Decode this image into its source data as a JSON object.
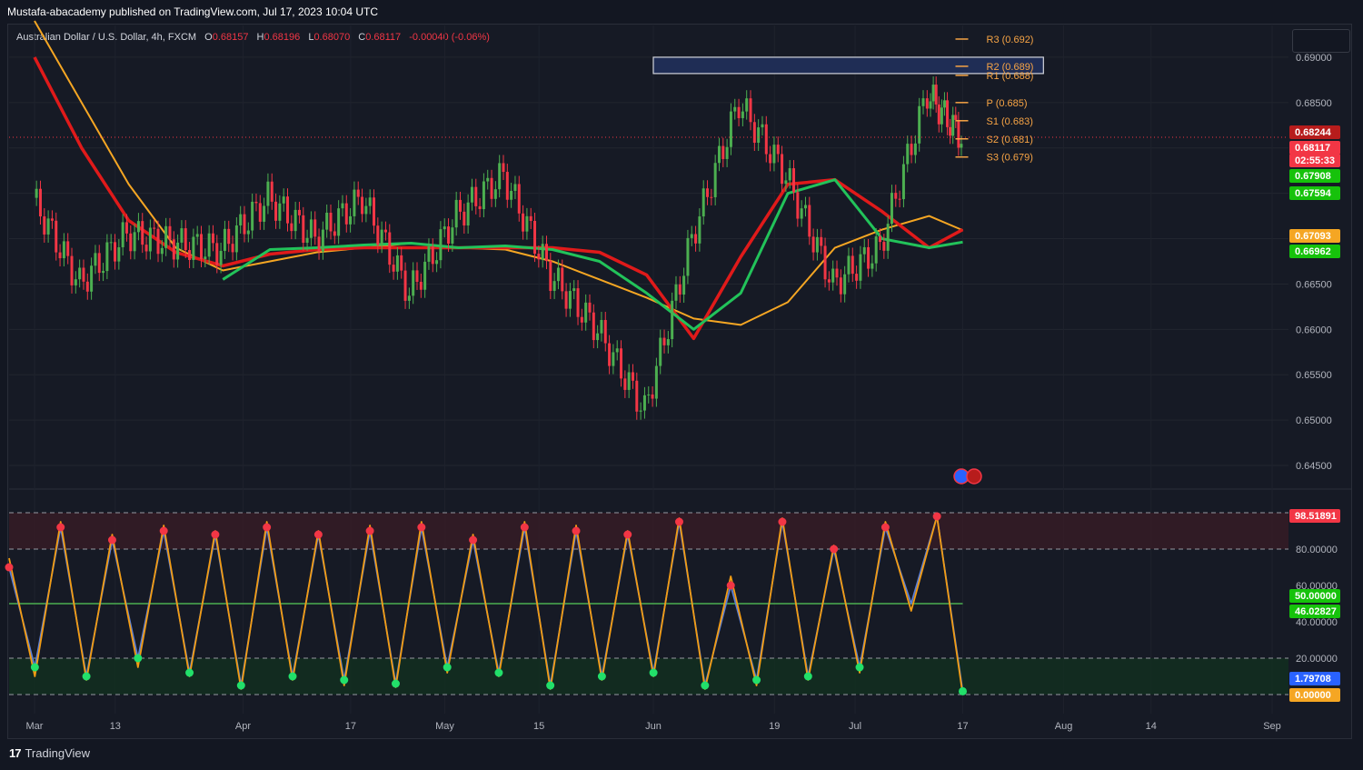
{
  "header": {
    "publisher": "Mustafa-abacademy published on TradingView.com, Jul 17, 2023 10:04 UTC"
  },
  "symbol": {
    "name": "Australian Dollar / U.S. Dollar, 4h, FXCM",
    "o_label": "O",
    "o": "0.68157",
    "h_label": "H",
    "h": "0.68196",
    "l_label": "L",
    "l": "0.68070",
    "c_label": "C",
    "c": "0.68117",
    "change": "-0.00040 (-0.06%)"
  },
  "footer": {
    "logo_text": "TradingView"
  },
  "colors": {
    "background": "#131722",
    "up": "#4caf50",
    "down": "#f23645",
    "ema_red": "#e01a1a",
    "ema_green": "#22c35a",
    "ema_orange": "#f39c12",
    "pivot": "#f7a445",
    "stoch_k": "#5b7fd6",
    "stoch_d": "#f39c12"
  },
  "chart_data": [
    {
      "type": "line",
      "title": "",
      "ylim": [
        0.6425,
        0.6935
      ],
      "y_ticks": [
        "0.69000",
        "0.68500",
        "0.68000",
        "0.67500",
        "0.67000",
        "0.66500",
        "0.66000",
        "0.65500",
        "0.65000",
        "0.64500"
      ],
      "x_ticks": [
        "Mar",
        "13",
        "Apr",
        "17",
        "May",
        "15",
        "Jun",
        "19",
        "Jul",
        "17",
        "Aug",
        "14",
        "Sep"
      ],
      "x": [
        "2023-03-01",
        "2023-03-08",
        "2023-03-15",
        "2023-03-22",
        "2023-03-29",
        "2023-04-05",
        "2023-04-12",
        "2023-04-19",
        "2023-04-26",
        "2023-05-03",
        "2023-05-10",
        "2023-05-17",
        "2023-05-24",
        "2023-05-31",
        "2023-06-07",
        "2023-06-14",
        "2023-06-21",
        "2023-06-28",
        "2023-07-05",
        "2023-07-12",
        "2023-07-17"
      ],
      "series": [
        {
          "values": [
            0.6745,
            0.665,
            0.6705,
            0.6695,
            0.6688,
            0.6745,
            0.67,
            0.6745,
            0.664,
            0.6725,
            0.677,
            0.666,
            0.66,
            0.651,
            0.67,
            0.685,
            0.677,
            0.665,
            0.669,
            0.686,
            0.68117
          ]
        }
      ],
      "overlays": {
        "ma_orange": [
          0.694,
          0.685,
          0.676,
          0.669,
          0.6665,
          0.6675,
          0.6685,
          0.669,
          0.6695,
          0.669,
          0.6688,
          0.6675,
          0.6655,
          0.6635,
          0.6612,
          0.6605,
          0.663,
          0.669,
          0.671,
          0.6725,
          0.67093
        ],
        "ema_red": [
          0.69,
          0.68,
          0.672,
          0.6685,
          0.667,
          0.6683,
          0.6688,
          0.669,
          0.669,
          0.669,
          0.669,
          0.669,
          0.6685,
          0.666,
          0.659,
          0.668,
          0.676,
          0.6765,
          0.673,
          0.669,
          0.671
        ],
        "ema_green": [
          null,
          null,
          null,
          null,
          0.6655,
          0.6688,
          0.669,
          0.6693,
          0.6695,
          0.669,
          0.6692,
          0.6688,
          0.6675,
          0.664,
          0.66,
          0.664,
          0.675,
          0.6765,
          0.67,
          0.669,
          0.66962
        ]
      },
      "pivots": [
        {
          "label": "R3 (0.692)",
          "value": 0.692
        },
        {
          "label": "R2 (0.689)",
          "value": 0.689
        },
        {
          "label": "R1 (0.688)",
          "value": 0.688
        },
        {
          "label": "P (0.685)",
          "value": 0.685
        },
        {
          "label": "S1 (0.683)",
          "value": 0.683
        },
        {
          "label": "S2 (0.681)",
          "value": 0.681
        },
        {
          "label": "S3 (0.679)",
          "value": 0.679
        }
      ],
      "resistance_zone": {
        "from_date": "2023-06-01",
        "to_date": "2023-07-29",
        "low": 0.6882,
        "high": 0.69
      },
      "price_labels": [
        {
          "text": "0.68244",
          "color": "#b71c1c"
        },
        {
          "text": "0.68117",
          "color": "#f23645"
        },
        {
          "text": "02:55:33",
          "color": "#f23645"
        },
        {
          "text": "0.67908",
          "color": "#16c20b"
        },
        {
          "text": "0.67594",
          "color": "#16c20b"
        },
        {
          "text": "0.67093",
          "color": "#f5a623"
        },
        {
          "text": "0.66962",
          "color": "#16c20b"
        }
      ]
    },
    {
      "type": "line",
      "title": "",
      "ylim": [
        0,
        100
      ],
      "y_ticks": [
        "80.00000",
        "60.00000",
        "40.00000",
        "20.00000"
      ],
      "series": [
        {
          "values": [
            70,
            15,
            92,
            10,
            85,
            20,
            90,
            12,
            88,
            5,
            92,
            10,
            88,
            8,
            90,
            6,
            92,
            15,
            85,
            12,
            92,
            5,
            90,
            10,
            88,
            12,
            95,
            5,
            60,
            8,
            95,
            10,
            80,
            15,
            92,
            50,
            98,
            1.8
          ]
        },
        {
          "values": [
            75,
            10,
            95,
            8,
            88,
            15,
            93,
            10,
            90,
            3,
            95,
            8,
            90,
            5,
            93,
            4,
            95,
            12,
            88,
            10,
            95,
            3,
            93,
            8,
            90,
            10,
            97,
            3,
            65,
            5,
            97,
            8,
            82,
            12,
            95,
            46,
            98,
            0
          ]
        }
      ],
      "levels": [
        80,
        50,
        20,
        0
      ],
      "value_labels": [
        {
          "text": "98.51891",
          "color": "#f23645"
        },
        {
          "text": "50.00000",
          "color": "#16c20b"
        },
        {
          "text": "46.02827",
          "color": "#16c20b"
        },
        {
          "text": "1.79708",
          "color": "#2962ff"
        },
        {
          "text": "0.00000",
          "color": "#f5a623"
        }
      ]
    }
  ]
}
